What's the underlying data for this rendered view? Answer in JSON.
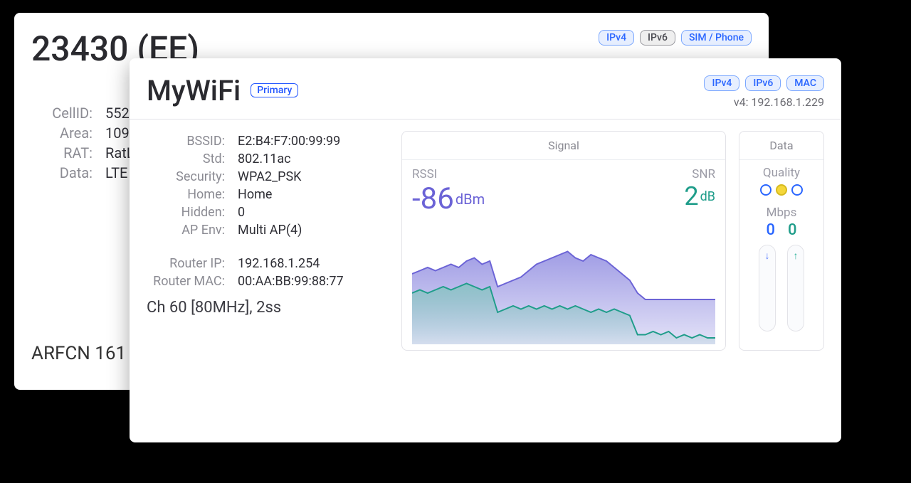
{
  "back": {
    "title": "23430 (EE)",
    "tabs": {
      "ipv4": "IPv4",
      "ipv6": "IPv6",
      "sim": "SIM / Phone"
    },
    "rows": [
      {
        "k": "CellID:",
        "v": "5520"
      },
      {
        "k": "Area:",
        "v": "10901"
      },
      {
        "k": "RAT:",
        "v": "RatLT"
      },
      {
        "k": "Data:",
        "v": "LTE"
      }
    ],
    "arfcn": "ARFCN 161"
  },
  "front": {
    "title": "MyWiFi",
    "primary_badge": "Primary",
    "tabs": {
      "ipv4": "IPv4",
      "ipv6": "IPv6",
      "mac": "MAC"
    },
    "ip_line": "v4: 192.168.1.229",
    "rows1": [
      {
        "k": "BSSID:",
        "v": "E2:B4:F7:00:99:99"
      },
      {
        "k": "Std:",
        "v": "802.11ac"
      },
      {
        "k": "Security:",
        "v": "WPA2_PSK"
      },
      {
        "k": "Home:",
        "v": "Home"
      },
      {
        "k": "Hidden:",
        "v": "0"
      },
      {
        "k": "AP Env:",
        "v": "Multi AP(4)"
      }
    ],
    "rows2": [
      {
        "k": "Router IP:",
        "v": "192.168.1.254"
      },
      {
        "k": "Router MAC:",
        "v": "00:AA:BB:99:88:77"
      }
    ],
    "channel": "Ch 60 [80MHz], 2ss",
    "signal": {
      "title": "Signal",
      "rssi_label": "RSSI",
      "rssi_value": "-86",
      "rssi_unit": "dBm",
      "snr_label": "SNR",
      "snr_value": "2",
      "snr_unit": "dB"
    },
    "data_panel": {
      "title": "Data",
      "quality_label": "Quality",
      "quality_level": 1,
      "mbps_label": "Mbps",
      "mbps_down": "0",
      "mbps_up": "0"
    }
  },
  "chart_data": {
    "type": "area",
    "x": [
      0,
      1,
      2,
      3,
      4,
      5,
      6,
      7,
      8,
      9,
      10,
      11,
      12,
      13,
      14,
      15,
      16,
      17,
      18,
      19,
      20,
      21,
      22,
      23,
      24,
      25,
      26,
      27,
      28,
      29,
      30,
      31,
      32,
      33,
      34,
      35,
      36,
      37,
      38,
      39
    ],
    "series": [
      {
        "name": "RSSI",
        "color_fill": "#8f8be0",
        "color_stroke": "#6b63d6",
        "values_dbm": [
          -78,
          -77,
          -76,
          -77,
          -76,
          -75,
          -76,
          -74,
          -73,
          -75,
          -74,
          -82,
          -81,
          -80,
          -79,
          -77,
          -75,
          -74,
          -73,
          -72,
          -71,
          -73,
          -74,
          -72,
          -73,
          -74,
          -76,
          -78,
          -80,
          -84,
          -86,
          -86,
          -86,
          -86,
          -86,
          -86,
          -86,
          -86,
          -86,
          -86
        ]
      },
      {
        "name": "SNR",
        "color_fill": "#7fc5bb",
        "color_stroke": "#1f9d8a",
        "values_db": [
          16,
          17,
          16,
          17,
          18,
          17,
          18,
          19,
          18,
          17,
          18,
          10,
          11,
          12,
          11,
          12,
          11,
          12,
          11,
          12,
          11,
          12,
          11,
          10,
          11,
          10,
          11,
          10,
          9,
          3,
          3,
          4,
          3,
          4,
          2,
          3,
          2,
          3,
          2,
          2
        ]
      }
    ],
    "ylim_rssi": [
      -100,
      -60
    ],
    "ylim_snr": [
      0,
      40
    ]
  }
}
